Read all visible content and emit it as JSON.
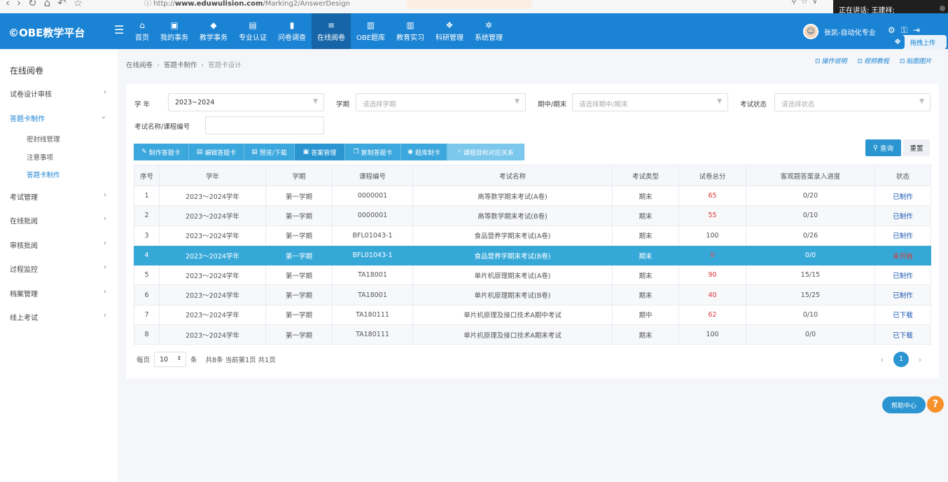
{
  "browser": {
    "url_prefix": "http://",
    "url_domain": "www.eduwulision.com",
    "url_path": "/Marking2/AnswerDesign"
  },
  "speaker": {
    "label": "正在讲话:",
    "name": "王建祥;"
  },
  "app": {
    "logo": "OBE教学平台"
  },
  "topnav": {
    "items": [
      {
        "label": "首页",
        "icon": "⌂"
      },
      {
        "label": "我的事务",
        "icon": "▣"
      },
      {
        "label": "教学事务",
        "icon": "◆"
      },
      {
        "label": "专业认证",
        "icon": "▤"
      },
      {
        "label": "问卷调查",
        "icon": "▮"
      },
      {
        "label": "在线阅卷",
        "icon": "≡"
      },
      {
        "label": "OBE题库",
        "icon": "▥"
      },
      {
        "label": "教育实习",
        "icon": "▥"
      },
      {
        "label": "科研管理",
        "icon": "❖"
      },
      {
        "label": "系统管理",
        "icon": "✲"
      }
    ],
    "active_index": 5,
    "user_name": "张凯-自动化专业",
    "drag_upload": "拖拽上传"
  },
  "sidebar": {
    "title": "在线阅卷",
    "items": [
      {
        "label": "试卷设计审核"
      },
      {
        "label": "答题卡制作"
      },
      {
        "label": "考试管理"
      },
      {
        "label": "在线批阅"
      },
      {
        "label": "审核批阅"
      },
      {
        "label": "过程监控"
      },
      {
        "label": "档案管理"
      },
      {
        "label": "线上考试"
      }
    ],
    "sub_items": [
      {
        "label": "密封线管理"
      },
      {
        "label": "注意事项"
      },
      {
        "label": "答题卡制作"
      }
    ]
  },
  "breadcrumb": [
    "在线阅卷",
    "答题卡制作",
    "答题卡设计"
  ],
  "help_links": [
    "操作说明",
    "视频教程",
    "贴图图片"
  ],
  "filters": {
    "year_label": "学  年",
    "year_value": "2023~2024",
    "term_label": "学期",
    "term_placeholder": "请选择学期",
    "period_label": "期中/期末",
    "period_placeholder": "请选择期中/期末",
    "status_label": "考试状态",
    "status_placeholder": "请选择状态",
    "name_label": "考试名称/课程编号",
    "query": "查询",
    "reset": "重置"
  },
  "toolbar": [
    {
      "label": "制作答题卡",
      "icon": "✎"
    },
    {
      "label": "编辑答题卡",
      "icon": "▤"
    },
    {
      "label": "预览/下载",
      "icon": "▤"
    },
    {
      "label": "答案管理",
      "icon": "▣"
    },
    {
      "label": "复制答题卡",
      "icon": "❐"
    },
    {
      "label": "题库制卡",
      "icon": "◉"
    },
    {
      "label": "课程目标对应关系",
      "icon": "⑂"
    }
  ],
  "table": {
    "headers": [
      "序号",
      "学年",
      "学期",
      "课程编号",
      "考试名称",
      "考试类型",
      "试卷总分",
      "客观题答案录入进度",
      "状态"
    ],
    "rows": [
      [
        "1",
        "2023～2024学年",
        "第一学期",
        "0000001",
        "高等数学期末考试(A卷)",
        "期末",
        "65",
        "0/20",
        "已制作"
      ],
      [
        "2",
        "2023～2024学年",
        "第一学期",
        "0000001",
        "高等数学期末考试(B卷)",
        "期末",
        "55",
        "0/10",
        "已制作"
      ],
      [
        "3",
        "2023～2024学年",
        "第一学期",
        "BFL01043-1",
        "食品营养学期末考试(A卷)",
        "期末",
        "100",
        "0/26",
        "已制作"
      ],
      [
        "4",
        "2023～2024学年",
        "第一学期",
        "BFL01043-1",
        "食品营养学期末考试(B卷)",
        "期末",
        "0",
        "0/0",
        "未开始"
      ],
      [
        "5",
        "2023～2024学年",
        "第一学期",
        "TA18001",
        "单片机原理期末考试(A卷)",
        "期末",
        "90",
        "15/15",
        "已制作"
      ],
      [
        "6",
        "2023～2024学年",
        "第一学期",
        "TA18001",
        "单片机原理期末考试(B卷)",
        "期末",
        "40",
        "15/25",
        "已制作"
      ],
      [
        "7",
        "2023～2024学年",
        "第一学期",
        "TA180111",
        "单片机原理及接口技术A期中考试",
        "期中",
        "62",
        "0/10",
        "已下载"
      ],
      [
        "8",
        "2023～2024学年",
        "第一学期",
        "TA180111",
        "单片机原理及接口技术A期末考试",
        "期末",
        "100",
        "0/0",
        "已下载"
      ]
    ],
    "selected_index": 3
  },
  "pager": {
    "per_page_label": "每页",
    "per_page": "10",
    "unit": "条",
    "summary": "共8条 当前第1页 共1页",
    "current": "1"
  },
  "help_center": "帮助中心"
}
